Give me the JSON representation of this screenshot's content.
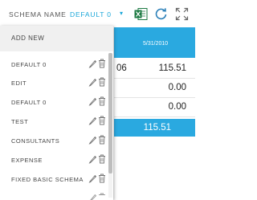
{
  "header": {
    "schema_label": "SCHEMA NAME",
    "schema_value": "DEFAULT 0",
    "caret": "▾",
    "icons": [
      "excel-icon",
      "refresh-icon",
      "expand-icon"
    ]
  },
  "grid": {
    "column_header": "5/31/2010",
    "rows": [
      {
        "left": "06",
        "value": "115.51"
      },
      {
        "left": "",
        "value": "0.00"
      },
      {
        "left": "",
        "value": "0.00"
      }
    ],
    "total": "115.51"
  },
  "dropdown": {
    "add_new": "ADD NEW",
    "items": [
      {
        "label": "DEFAULT 0"
      },
      {
        "label": "EDIT"
      },
      {
        "label": "DEFAULT 0"
      },
      {
        "label": "TEST"
      },
      {
        "label": "CONSULTANTS"
      },
      {
        "label": "EXPENSE"
      },
      {
        "label": "FIXED BASIC SCHEMA"
      }
    ]
  },
  "colors": {
    "accent": "#2aa9e0",
    "schema_value": "#1aa7d9",
    "excel_green": "#1d7a43"
  }
}
